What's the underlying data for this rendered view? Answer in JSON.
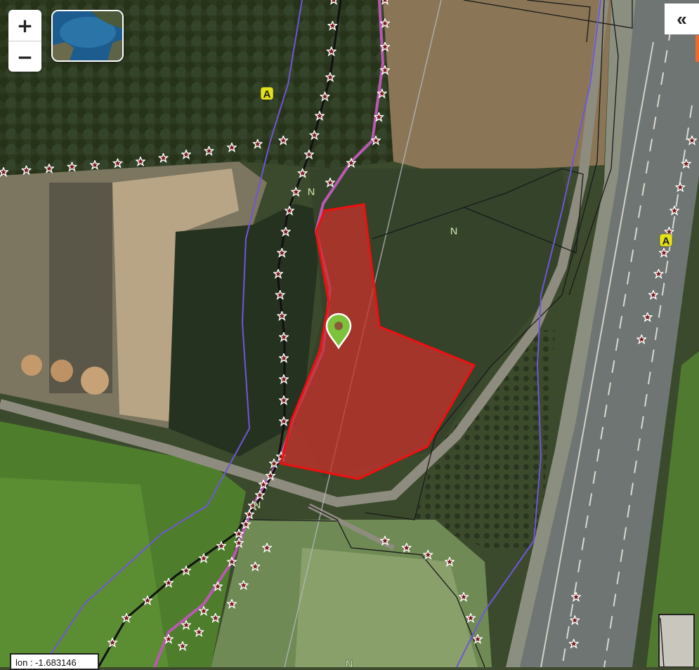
{
  "map": {
    "zone_labels": [
      {
        "text": "A",
        "kind": "A"
      },
      {
        "text": "N",
        "kind": "N"
      },
      {
        "text": "N",
        "kind": "N"
      },
      {
        "text": "A",
        "kind": "A"
      },
      {
        "text": "N",
        "kind": "N"
      },
      {
        "text": "N",
        "kind": "N"
      }
    ],
    "colors": {
      "parcel_fill": "#c8302c",
      "parcel_stroke": "#ee1010",
      "marker": "#7cc23a",
      "zone_A_fill": "#e3e21a",
      "zone_N_fill": "#bfe3a0",
      "boundary_purple": "#6f57d6",
      "star_line": "#7a1a1a"
    },
    "marker_icon": "location-pin-icon"
  },
  "controls": {
    "zoom_in_label": "+",
    "zoom_out_label": "−",
    "collapse_label": "«"
  },
  "coordinates": {
    "text": "lon : -1.683146"
  }
}
